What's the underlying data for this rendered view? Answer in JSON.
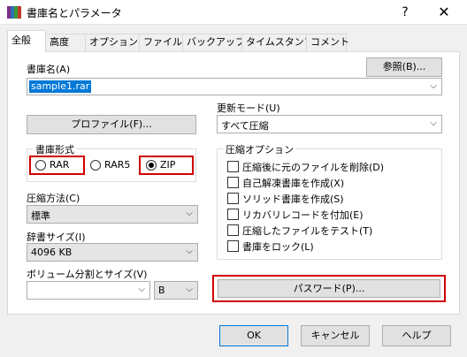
{
  "window": {
    "title": "書庫名とパラメータ",
    "help": "?",
    "close": "✕"
  },
  "tabs": [
    "全般",
    "高度",
    "オプション",
    "ファイル",
    "バックアップ",
    "タイムスタンプ",
    "コメント"
  ],
  "archive_name": {
    "label": "書庫名(A)",
    "value": "sample1.rar",
    "browse_label": "参照(B)..."
  },
  "profile_button": "プロファイル(F)...",
  "update_mode": {
    "label": "更新モード(U)",
    "value": "すべて圧縮"
  },
  "archive_format": {
    "label": "書庫形式",
    "options": [
      "RAR",
      "RAR5",
      "ZIP"
    ],
    "selected": "ZIP"
  },
  "compression_method": {
    "label": "圧縮方法(C)",
    "value": "標準"
  },
  "dictionary_size": {
    "label": "辞書サイズ(I)",
    "value": "4096 KB"
  },
  "volume_split": {
    "label": "ボリューム分割とサイズ(V)",
    "value": "",
    "unit": "B"
  },
  "compression_options": {
    "label": "圧縮オプション",
    "items": [
      "圧縮後に元のファイルを削除(D)",
      "自己解凍書庫を作成(X)",
      "ソリッド書庫を作成(S)",
      "リカバリレコードを付加(E)",
      "圧縮したファイルをテスト(T)",
      "書庫をロック(L)"
    ]
  },
  "password_button": "パスワード(P)...",
  "footer": {
    "ok": "OK",
    "cancel": "キャンセル",
    "help": "ヘルプ"
  },
  "colors": {
    "highlight": "#d00000",
    "selection": "#0078d7"
  }
}
